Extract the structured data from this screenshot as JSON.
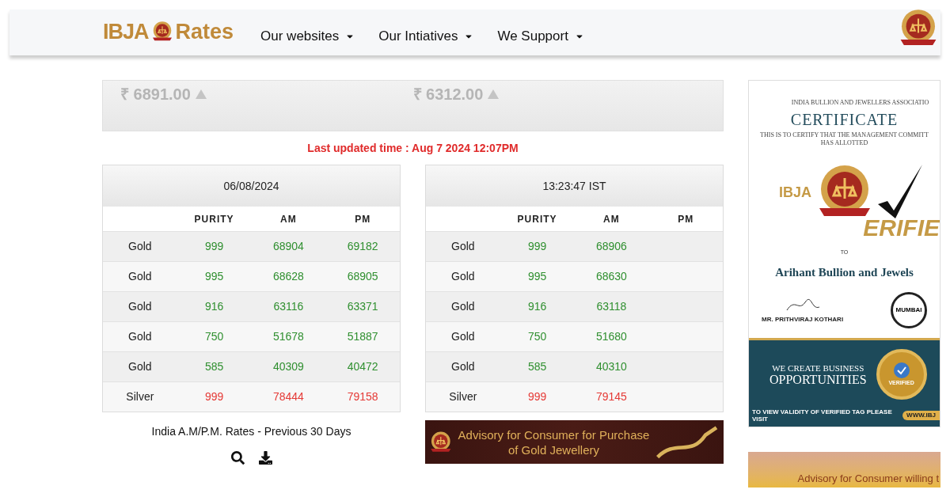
{
  "header": {
    "logo_left": "IBJA",
    "logo_right": "Rates",
    "nav": [
      {
        "label": "Our websites"
      },
      {
        "label": "Our Intiatives"
      },
      {
        "label": "We Support"
      }
    ]
  },
  "ticker": [
    {
      "price": "₹ 6891.00"
    },
    {
      "price": "₹ 6312.00"
    }
  ],
  "last_updated": "Last updated time : Aug 7 2024 12:07PM",
  "tables": [
    {
      "title": "06/08/2024",
      "columns": [
        "PURITY",
        "AM",
        "PM"
      ],
      "rows": [
        {
          "metal": "Gold",
          "kind": "gold",
          "purity": "999",
          "am": "68904",
          "pm": "69182"
        },
        {
          "metal": "Gold",
          "kind": "gold",
          "purity": "995",
          "am": "68628",
          "pm": "68905"
        },
        {
          "metal": "Gold",
          "kind": "gold",
          "purity": "916",
          "am": "63116",
          "pm": "63371"
        },
        {
          "metal": "Gold",
          "kind": "gold",
          "purity": "750",
          "am": "51678",
          "pm": "51887"
        },
        {
          "metal": "Gold",
          "kind": "gold",
          "purity": "585",
          "am": "40309",
          "pm": "40472"
        },
        {
          "metal": "Silver",
          "kind": "silver",
          "purity": "999",
          "am": "78444",
          "pm": "79158"
        }
      ]
    },
    {
      "title": "13:23:47 IST",
      "columns": [
        "PURITY",
        "AM",
        "PM"
      ],
      "rows": [
        {
          "metal": "Gold",
          "kind": "gold",
          "purity": "999",
          "am": "68906"
        },
        {
          "metal": "Gold",
          "kind": "gold",
          "purity": "995",
          "am": "68630"
        },
        {
          "metal": "Gold",
          "kind": "gold",
          "purity": "916",
          "am": "63118"
        },
        {
          "metal": "Gold",
          "kind": "gold",
          "purity": "750",
          "am": "51680"
        },
        {
          "metal": "Gold",
          "kind": "gold",
          "purity": "585",
          "am": "40310"
        },
        {
          "metal": "Silver",
          "kind": "silver",
          "purity": "999",
          "am": "79145"
        }
      ]
    }
  ],
  "history_link": "India A.M/P.M. Rates - Previous 30 Days",
  "advisory_banner": {
    "line1": "Advisory for Consumer for Purchase",
    "line2": "of Gold Jewellery"
  },
  "certificate": {
    "association": "INDIA BULLION AND JEWELLERS ASSOCIATIO",
    "title": "CERTIFICATE",
    "certify": "THIS IS TO CERTIFY THAT THE MANAGEMENT COMMITT",
    "allotted": "HAS ALLOTTED",
    "seal_text": "IBJA",
    "verified": "ERIFIE",
    "to": "TO",
    "company": "Arihant Bullion and Jewels",
    "signatory": "MR. PRITHVIRAJ KOTHARI",
    "stamp": "MUMBAI",
    "slogan1": "WE CREATE BUSINESS",
    "slogan2": "OPPORTUNITIES",
    "badge": "VERIFIED",
    "footer": "TO VIEW VALIDITY OF VERIFIED TAG PLEASE VISIT",
    "footer_url": "WWW.IBJ"
  },
  "advisory_banner_2": {
    "line1": "Advisory for Consumer willing t"
  }
}
